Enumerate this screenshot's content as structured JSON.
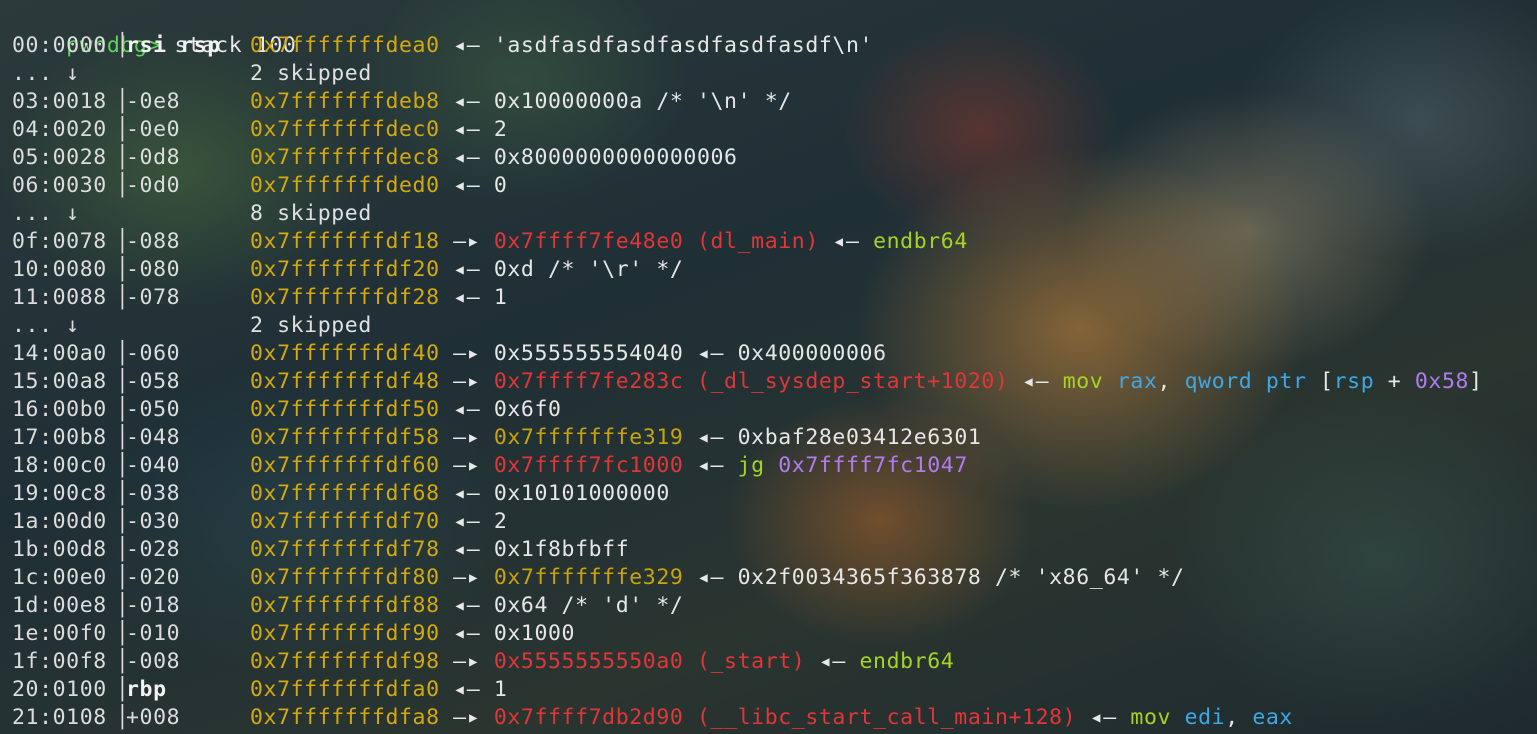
{
  "terminal": {
    "prompt": "pwndbg>",
    "command": "stack 100",
    "rows": [
      {
        "kind": "entry",
        "idx": "00:0000",
        "off": "rsi rsp",
        "off_is_reg": true,
        "addr": "0x7fffffffdea0",
        "rest": [
          {
            "t": "arrow",
            "v": "◂— "
          },
          {
            "t": "val",
            "v": "'asdfasdfasdfasdfasdfasdf\\n'"
          }
        ]
      },
      {
        "kind": "skip",
        "idx": "... ↓",
        "text": "2 skipped"
      },
      {
        "kind": "entry",
        "idx": "03:0018",
        "off": "-0e8",
        "addr": "0x7fffffffdeb8",
        "rest": [
          {
            "t": "arrow",
            "v": "◂— "
          },
          {
            "t": "val",
            "v": "0x10000000a /* '\\n' */"
          }
        ]
      },
      {
        "kind": "entry",
        "idx": "04:0020",
        "off": "-0e0",
        "addr": "0x7fffffffdec0",
        "rest": [
          {
            "t": "arrow",
            "v": "◂— "
          },
          {
            "t": "val",
            "v": "2"
          }
        ]
      },
      {
        "kind": "entry",
        "idx": "05:0028",
        "off": "-0d8",
        "addr": "0x7fffffffdec8",
        "rest": [
          {
            "t": "arrow",
            "v": "◂— "
          },
          {
            "t": "val",
            "v": "0x8000000000000006"
          }
        ]
      },
      {
        "kind": "entry",
        "idx": "06:0030",
        "off": "-0d0",
        "addr": "0x7fffffffded0",
        "rest": [
          {
            "t": "arrow",
            "v": "◂— "
          },
          {
            "t": "val",
            "v": "0"
          }
        ]
      },
      {
        "kind": "skip",
        "idx": "... ↓",
        "text": "8 skipped"
      },
      {
        "kind": "entry",
        "idx": "0f:0078",
        "off": "-088",
        "addr": "0x7fffffffdf18",
        "rest": [
          {
            "t": "arrow",
            "v": "—▸ "
          },
          {
            "t": "code",
            "v": "0x7ffff7fe48e0 (dl_main)"
          },
          {
            "t": "arrow",
            "v": " ◂— "
          },
          {
            "t": "insn",
            "v": "endbr64"
          }
        ]
      },
      {
        "kind": "entry",
        "idx": "10:0080",
        "off": "-080",
        "addr": "0x7fffffffdf20",
        "rest": [
          {
            "t": "arrow",
            "v": "◂— "
          },
          {
            "t": "val",
            "v": "0xd /* '\\r' */"
          }
        ]
      },
      {
        "kind": "entry",
        "idx": "11:0088",
        "off": "-078",
        "addr": "0x7fffffffdf28",
        "rest": [
          {
            "t": "arrow",
            "v": "◂— "
          },
          {
            "t": "val",
            "v": "1"
          }
        ]
      },
      {
        "kind": "skip",
        "idx": "... ↓",
        "text": "2 skipped"
      },
      {
        "kind": "entry",
        "idx": "14:00a0",
        "off": "-060",
        "addr": "0x7fffffffdf40",
        "rest": [
          {
            "t": "arrow",
            "v": "—▸ "
          },
          {
            "t": "val",
            "v": "0x555555554040"
          },
          {
            "t": "arrow",
            "v": " ◂— "
          },
          {
            "t": "val",
            "v": "0x400000006"
          }
        ]
      },
      {
        "kind": "entry",
        "idx": "15:00a8",
        "off": "-058",
        "addr": "0x7fffffffdf48",
        "rest": [
          {
            "t": "arrow",
            "v": "—▸ "
          },
          {
            "t": "code",
            "v": "0x7ffff7fe283c (_dl_sysdep_start+1020)"
          },
          {
            "t": "arrow",
            "v": " ◂— "
          },
          {
            "t": "insn",
            "v": "mov "
          },
          {
            "t": "reg",
            "v": "rax"
          },
          {
            "t": "plain",
            "v": ", "
          },
          {
            "t": "kw",
            "v": "qword ptr"
          },
          {
            "t": "plain",
            "v": " ["
          },
          {
            "t": "reg",
            "v": "rsp"
          },
          {
            "t": "plain",
            "v": " + "
          },
          {
            "t": "num",
            "v": "0x58"
          },
          {
            "t": "plain",
            "v": "]"
          }
        ]
      },
      {
        "kind": "entry",
        "idx": "16:00b0",
        "off": "-050",
        "addr": "0x7fffffffdf50",
        "rest": [
          {
            "t": "arrow",
            "v": "◂— "
          },
          {
            "t": "val",
            "v": "0x6f0"
          }
        ]
      },
      {
        "kind": "entry",
        "idx": "17:00b8",
        "off": "-048",
        "addr": "0x7fffffffdf58",
        "rest": [
          {
            "t": "arrow",
            "v": "—▸ "
          },
          {
            "t": "data",
            "v": "0x7fffffffe319"
          },
          {
            "t": "arrow",
            "v": " ◂— "
          },
          {
            "t": "val",
            "v": "0xbaf28e03412e6301"
          }
        ]
      },
      {
        "kind": "entry",
        "idx": "18:00c0",
        "off": "-040",
        "addr": "0x7fffffffdf60",
        "rest": [
          {
            "t": "arrow",
            "v": "—▸ "
          },
          {
            "t": "code",
            "v": "0x7ffff7fc1000"
          },
          {
            "t": "arrow",
            "v": " ◂— "
          },
          {
            "t": "insn",
            "v": "jg "
          },
          {
            "t": "num",
            "v": "0x7ffff7fc1047"
          }
        ]
      },
      {
        "kind": "entry",
        "idx": "19:00c8",
        "off": "-038",
        "addr": "0x7fffffffdf68",
        "rest": [
          {
            "t": "arrow",
            "v": "◂— "
          },
          {
            "t": "val",
            "v": "0x10101000000"
          }
        ]
      },
      {
        "kind": "entry",
        "idx": "1a:00d0",
        "off": "-030",
        "addr": "0x7fffffffdf70",
        "rest": [
          {
            "t": "arrow",
            "v": "◂— "
          },
          {
            "t": "val",
            "v": "2"
          }
        ]
      },
      {
        "kind": "entry",
        "idx": "1b:00d8",
        "off": "-028",
        "addr": "0x7fffffffdf78",
        "rest": [
          {
            "t": "arrow",
            "v": "◂— "
          },
          {
            "t": "val",
            "v": "0x1f8bfbff"
          }
        ]
      },
      {
        "kind": "entry",
        "idx": "1c:00e0",
        "off": "-020",
        "addr": "0x7fffffffdf80",
        "rest": [
          {
            "t": "arrow",
            "v": "—▸ "
          },
          {
            "t": "data",
            "v": "0x7fffffffe329"
          },
          {
            "t": "arrow",
            "v": " ◂— "
          },
          {
            "t": "val",
            "v": "0x2f0034365f363878 /* 'x86_64' */"
          }
        ]
      },
      {
        "kind": "entry",
        "idx": "1d:00e8",
        "off": "-018",
        "addr": "0x7fffffffdf88",
        "rest": [
          {
            "t": "arrow",
            "v": "◂— "
          },
          {
            "t": "val",
            "v": "0x64 /* 'd' */"
          }
        ]
      },
      {
        "kind": "entry",
        "idx": "1e:00f0",
        "off": "-010",
        "addr": "0x7fffffffdf90",
        "rest": [
          {
            "t": "arrow",
            "v": "◂— "
          },
          {
            "t": "val",
            "v": "0x1000"
          }
        ]
      },
      {
        "kind": "entry",
        "idx": "1f:00f8",
        "off": "-008",
        "addr": "0x7fffffffdf98",
        "rest": [
          {
            "t": "arrow",
            "v": "—▸ "
          },
          {
            "t": "code",
            "v": "0x5555555550a0 (_start)"
          },
          {
            "t": "arrow",
            "v": " ◂— "
          },
          {
            "t": "insn",
            "v": "endbr64"
          }
        ]
      },
      {
        "kind": "entry",
        "idx": "20:0100",
        "off": "rbp",
        "off_is_reg": true,
        "addr": "0x7fffffffdfa0",
        "rest": [
          {
            "t": "arrow",
            "v": "◂— "
          },
          {
            "t": "val",
            "v": "1"
          }
        ]
      },
      {
        "kind": "entry",
        "idx": "21:0108",
        "off": "+008",
        "addr": "0x7fffffffdfa8",
        "rest": [
          {
            "t": "arrow",
            "v": "—▸ "
          },
          {
            "t": "code",
            "v": "0x7ffff7db2d90 (__libc_start_call_main+128)"
          },
          {
            "t": "arrow",
            "v": " ◂— "
          },
          {
            "t": "insn",
            "v": "mov "
          },
          {
            "t": "reg",
            "v": "edi"
          },
          {
            "t": "plain",
            "v": ", "
          },
          {
            "t": "reg",
            "v": "eax"
          }
        ]
      }
    ]
  },
  "colors": {
    "prompt": "#5fd35a",
    "stack_address": "#d4a90e",
    "code_pointer": "#e23636",
    "instruction": "#a5d323",
    "register_operand": "#3ea8e6",
    "immediate": "#b07cf0"
  }
}
